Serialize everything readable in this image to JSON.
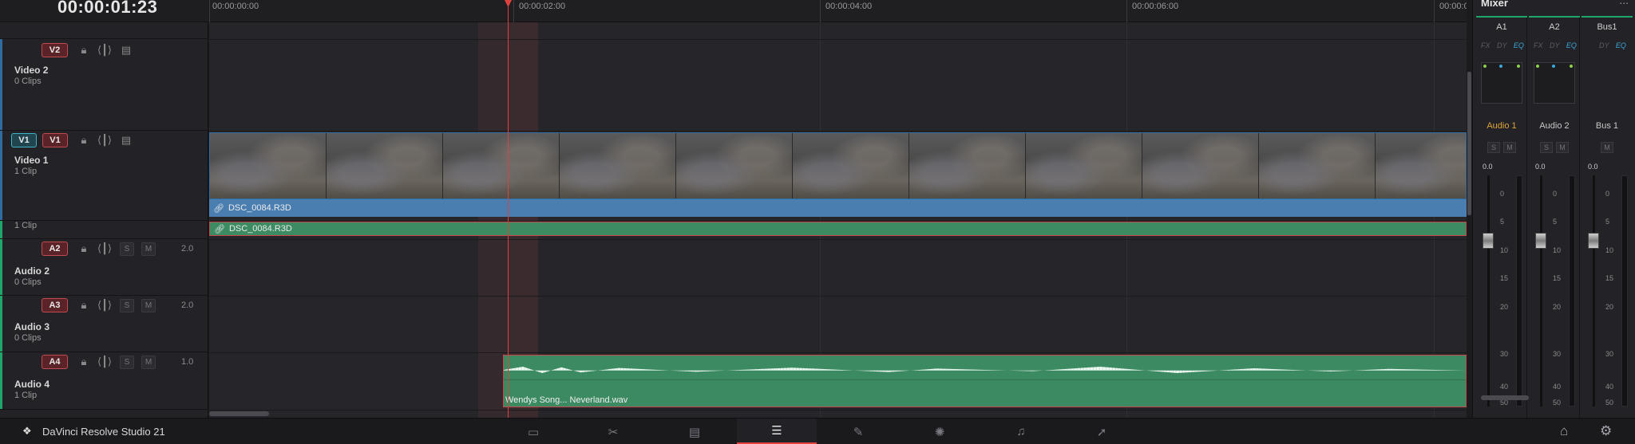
{
  "timecode": "00:00:01:23",
  "ruler": {
    "labels": [
      "00:00:00:00",
      "00:00:02:00",
      "00:00:04:00",
      "00:00:06:00",
      "00:00:0"
    ]
  },
  "tracks": {
    "v2": {
      "badge": "V2",
      "name": "Video 2",
      "clips": "0 Clips"
    },
    "v1": {
      "source_badge": "V1",
      "badge": "V1",
      "name": "Video 1",
      "clips": "1 Clip"
    },
    "a1": {
      "clips": "1 Clip"
    },
    "a2": {
      "badge": "A2",
      "name": "Audio 2",
      "clips": "0 Clips",
      "solo": "S",
      "mute": "M",
      "gain": "2.0"
    },
    "a3": {
      "badge": "A3",
      "name": "Audio 3",
      "clips": "0 Clips",
      "solo": "S",
      "mute": "M",
      "gain": "2.0"
    },
    "a4": {
      "badge": "A4",
      "name": "Audio 4",
      "clips": "1 Clip",
      "solo": "S",
      "mute": "M",
      "gain": "1.0"
    }
  },
  "clips": {
    "video_clip_name": "DSC_0084.R3D",
    "linked_audio_name": "DSC_0084.R3D",
    "audio4_clip_name": "Wendys Song... Neverland.wav"
  },
  "mixer": {
    "title": "Mixer",
    "menu": "...",
    "channels": [
      {
        "top": "A1",
        "fx": "FX",
        "dy": "DY",
        "eq": "EQ",
        "name": "Audio 1",
        "solo": "S",
        "mute": "M",
        "value": "0.0",
        "name_color": "#e0a43a"
      },
      {
        "top": "A2",
        "fx": "FX",
        "dy": "DY",
        "eq": "EQ",
        "name": "Audio 2",
        "solo": "S",
        "mute": "M",
        "value": "0.0",
        "name_color": "#d0d0d0"
      },
      {
        "top": "Bus1",
        "dy": "DY",
        "eq": "EQ",
        "name": "Bus 1",
        "mute": "M",
        "value": "0.0",
        "name_color": "#d0d0d0"
      }
    ],
    "scale": [
      "0",
      "5",
      "10",
      "15",
      "20",
      "30",
      "40",
      "50"
    ]
  },
  "bottom": {
    "app_name": "DaVinci Resolve Studio 21",
    "pages": [
      {
        "id": "media",
        "icon": "▭"
      },
      {
        "id": "cut",
        "icon": "✂"
      },
      {
        "id": "edit",
        "icon": "▤"
      },
      {
        "id": "fairlight-timeline",
        "icon": "☰"
      },
      {
        "id": "fusion",
        "icon": "✎"
      },
      {
        "id": "color",
        "icon": "✺"
      },
      {
        "id": "fairlight",
        "icon": "♫"
      },
      {
        "id": "deliver",
        "icon": "➚"
      }
    ],
    "active_page": "fairlight-timeline"
  },
  "colors": {
    "video_clip": "#4a7eb1",
    "audio_clip": "#3b8a62",
    "playhead": "#e0413f",
    "selection_border": "#c8464a"
  }
}
